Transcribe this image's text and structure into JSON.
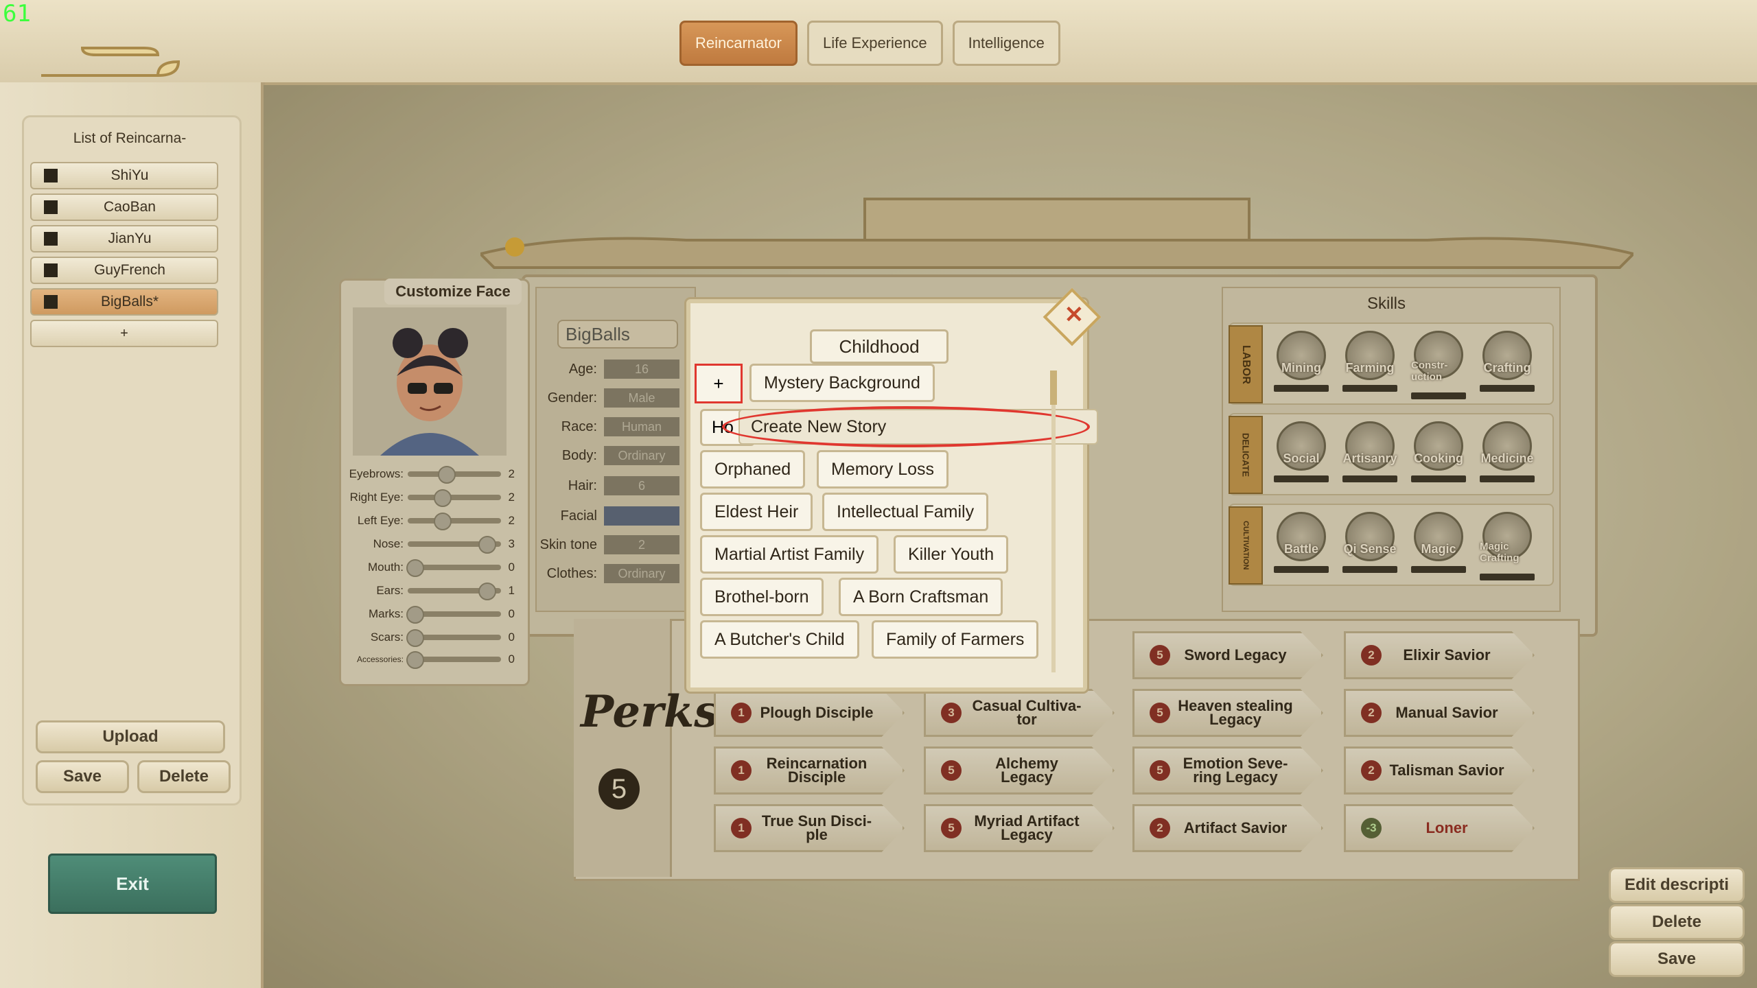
{
  "fps": "61",
  "top_tabs": [
    {
      "label": "Reincarnator",
      "active": true
    },
    {
      "label": "Life Experience",
      "active": false
    },
    {
      "label": "Intelligence",
      "active": false
    }
  ],
  "left_panel": {
    "title": "List of Reincarna-",
    "items": [
      {
        "label": "ShiYu",
        "selected": false
      },
      {
        "label": "CaoBan",
        "selected": false
      },
      {
        "label": "JianYu",
        "selected": false
      },
      {
        "label": "GuyFrench",
        "selected": false
      },
      {
        "label": "BigBalls*",
        "selected": true
      }
    ],
    "add_label": "+",
    "upload_label": "Upload",
    "save_label": "Save",
    "delete_label": "Delete",
    "exit_label": "Exit"
  },
  "face": {
    "title": "Customize Face",
    "sliders": [
      {
        "label": "Eyebrows:",
        "value": "2",
        "level": 0.4
      },
      {
        "label": "Right Eye:",
        "value": "2",
        "level": 0.35
      },
      {
        "label": "Left Eye:",
        "value": "2",
        "level": 0.35
      },
      {
        "label": "Nose:",
        "value": "3",
        "level": 0.92
      },
      {
        "label": "Mouth:",
        "value": "0",
        "level": 0.0
      },
      {
        "label": "Ears:",
        "value": "1",
        "level": 0.92
      },
      {
        "label": "Marks:",
        "value": "0",
        "level": 0.0
      },
      {
        "label": "Scars:",
        "value": "0",
        "level": 0.0
      },
      {
        "label": "Accessories:",
        "value": "0",
        "level": 0.0
      }
    ]
  },
  "base_info": {
    "name": "BigBalls",
    "rows": [
      {
        "label": "Age:",
        "value": "16"
      },
      {
        "label": "Gender:",
        "value": "Male"
      },
      {
        "label": "Race:",
        "value": "Human"
      },
      {
        "label": "Body:",
        "value": "Ordinary"
      },
      {
        "label": "Hair:",
        "value": "6"
      },
      {
        "label": "Facial",
        "value": ""
      },
      {
        "label": "Skin tone",
        "value": "2"
      },
      {
        "label": "Clothes:",
        "value": "Ordinary"
      }
    ]
  },
  "skills": {
    "title": "Skills",
    "groups": [
      {
        "category": "LABOR",
        "items": [
          "Mining",
          "Farming",
          "Constr-uction",
          "Crafting"
        ]
      },
      {
        "category": "DELICATE",
        "items": [
          "Social",
          "Artisanry",
          "Cooking",
          "Medicine"
        ]
      },
      {
        "category": "CULTIVATION",
        "items": [
          "Battle",
          "Qi Sense",
          "Magic",
          "Magic Crafting"
        ]
      }
    ]
  },
  "perks": {
    "label": "Perks",
    "count": "5",
    "grid": [
      [
        {
          "cost": "",
          "name": ""
        },
        {
          "cost": "",
          "name": ""
        },
        {
          "cost": "5",
          "name": "Sword Legacy"
        },
        {
          "cost": "2",
          "name": "Elixir Savior"
        }
      ],
      [
        {
          "cost": "1",
          "name": "Plough Disciple"
        },
        {
          "cost": "3",
          "name": "Casual Cultiva-tor"
        },
        {
          "cost": "5",
          "name": "Heaven stealing Legacy"
        },
        {
          "cost": "2",
          "name": "Manual Savior"
        }
      ],
      [
        {
          "cost": "1",
          "name": "Reincarnation Disciple"
        },
        {
          "cost": "5",
          "name": "Alchemy Legacy"
        },
        {
          "cost": "5",
          "name": "Emotion Seve-ring Legacy"
        },
        {
          "cost": "2",
          "name": "Talisman Savior"
        }
      ],
      [
        {
          "cost": "1",
          "name": "True Sun Disci-ple"
        },
        {
          "cost": "5",
          "name": "Myriad Artifact Legacy"
        },
        {
          "cost": "2",
          "name": "Artifact Savior"
        },
        {
          "cost": "-3",
          "name": "Loner"
        }
      ]
    ]
  },
  "popup": {
    "title": "Childhood",
    "close_symbol": "✕",
    "add_label": "+",
    "first_option": "Mystery Background",
    "hidden_option_prefix": "Ho",
    "dropdown_item": "Create New Story",
    "options": [
      [
        "Orphaned",
        "Memory Loss"
      ],
      [
        "Eldest Heir",
        "Intellectual Family"
      ],
      [
        "Martial Artist Family",
        "Killer Youth"
      ],
      [
        "Brothel-born",
        "A Born Craftsman"
      ],
      [
        "A Butcher's Child",
        "Family of Farmers"
      ]
    ]
  },
  "right_buttons": {
    "edit": "Edit descripti",
    "delete": "Delete",
    "save": "Save"
  }
}
